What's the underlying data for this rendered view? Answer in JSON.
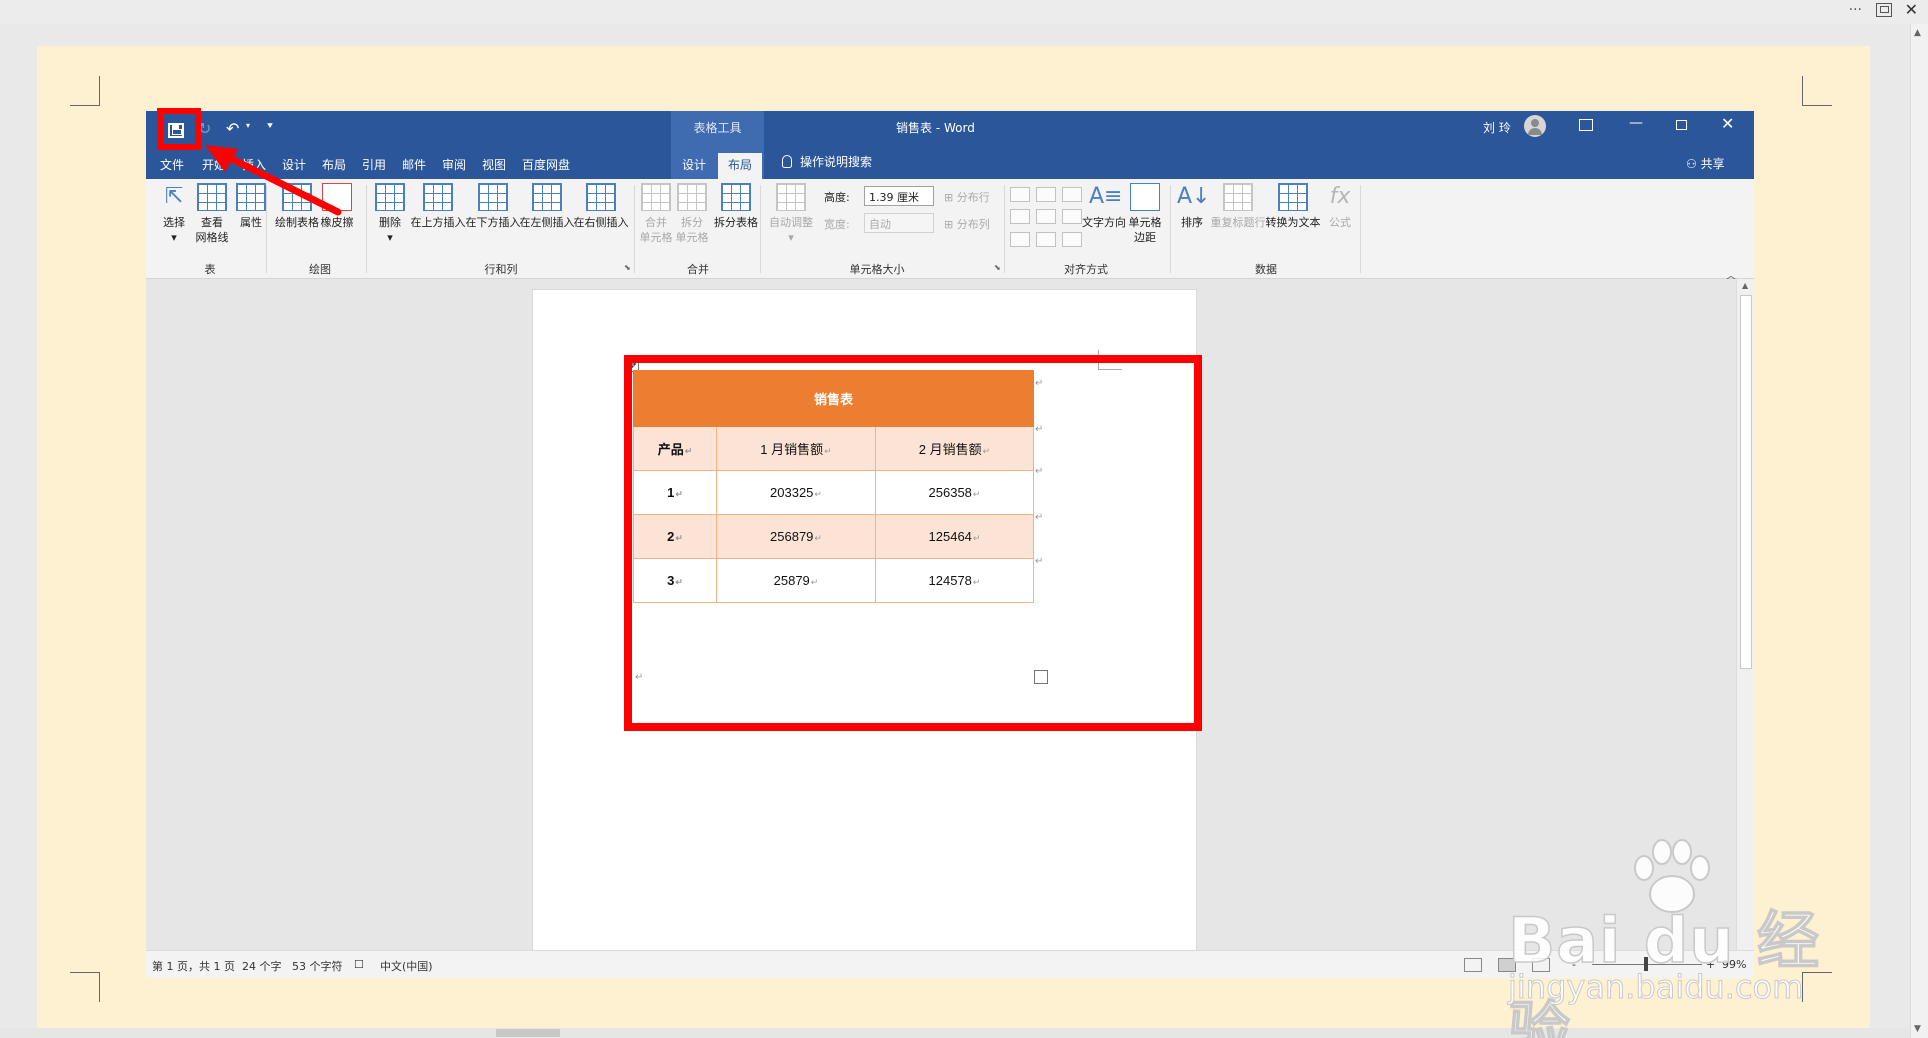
{
  "host": {
    "dots": "···",
    "close": "✕"
  },
  "word": {
    "context_tab": "表格工具",
    "title": "销售表",
    "title_sep": "-",
    "app": "Word",
    "user": "刘 玲",
    "tabs": [
      "文件",
      "开始",
      "插入",
      "设计",
      "布局",
      "引用",
      "邮件",
      "审阅",
      "视图",
      "百度网盘",
      "设计",
      "布局"
    ],
    "active_tab": "布局",
    "tell_me": "操作说明搜索",
    "share": "共享"
  },
  "ribbon": {
    "groups": {
      "table": "表",
      "draw": "绘图",
      "rows_cols": "行和列",
      "merge": "合并",
      "cell_size": "单元格大小",
      "alignment": "对齐方式",
      "data": "数据"
    },
    "buttons": {
      "select": "选择",
      "view_gridlines_1": "查看",
      "view_gridlines_2": "网格线",
      "properties": "属性",
      "draw_table": "绘制表格",
      "eraser": "橡皮擦",
      "delete": "删除",
      "insert_above": "在上方插入",
      "insert_below": "在下方插入",
      "insert_left": "在左侧插入",
      "insert_right": "在右侧插入",
      "merge_cells_1": "合并",
      "merge_cells_2": "单元格",
      "split_cells_1": "拆分",
      "split_cells_2": "单元格",
      "split_table": "拆分表格",
      "autofit": "自动调整",
      "distribute_rows": "分布行",
      "distribute_cols": "分布列",
      "text_direction": "文字方向",
      "cell_margins_1": "单元格",
      "cell_margins_2": "边距",
      "sort": "排序",
      "repeat_header": "重复标题行",
      "convert_to_text": "转换为文本",
      "formula": "公式"
    },
    "height_label": "高度:",
    "height_value": "1.39 厘米",
    "width_label": "宽度:",
    "width_value": "自动"
  },
  "table": {
    "title": "销售表",
    "headers": [
      "产品",
      "1 月销售额",
      "2 月销售额"
    ],
    "rows": [
      [
        "1",
        "203325",
        "256358"
      ],
      [
        "2",
        "256879",
        "125464"
      ],
      [
        "3",
        "25879",
        "124578"
      ]
    ],
    "para_mark": "↵"
  },
  "status": {
    "page": "第 1 页，共 1 页",
    "words": "24 个字",
    "chars": "53 个字符",
    "lang": "中文(中国)",
    "zoom": "99%",
    "zoom_minus": "-",
    "zoom_plus": "+"
  },
  "watermark": {
    "brand": "Bai du 经验",
    "url": "jingyan.baidu.com"
  },
  "colors": {
    "word_blue": "#2b579a",
    "table_orange": "#ed7d31",
    "band": "#fbe4d5",
    "annotation_red": "#ff0000"
  }
}
